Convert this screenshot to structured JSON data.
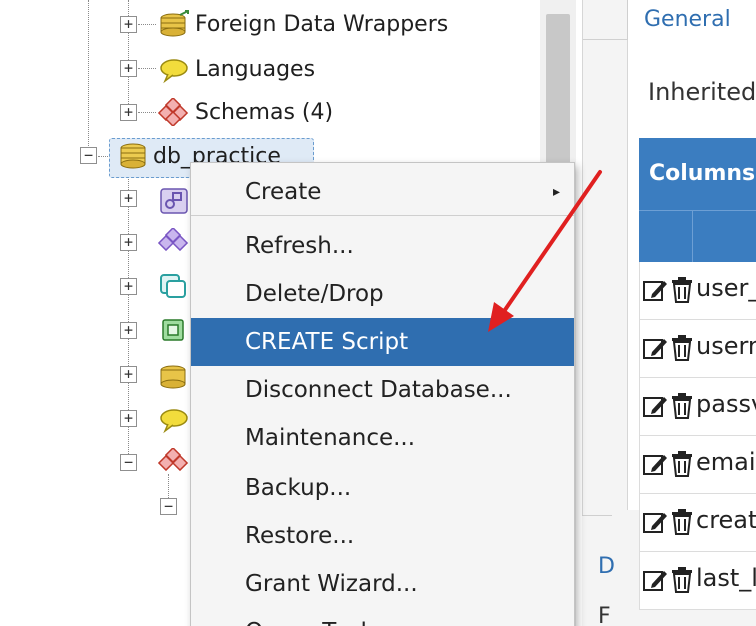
{
  "tree": {
    "nodes": [
      {
        "label": "Foreign Data Wrappers",
        "icon": "foreign-data-wrapper-icon"
      },
      {
        "label": "Languages",
        "icon": "language-icon"
      },
      {
        "label": "Schemas (4)",
        "icon": "schema-icon"
      },
      {
        "label": "db_practice",
        "icon": "database-icon"
      }
    ],
    "expander_collapsed": "+",
    "expander_expanded": "−"
  },
  "context_menu": {
    "items": [
      {
        "label": "Create",
        "submenu_caret": "▸"
      },
      {
        "label": "Refresh..."
      },
      {
        "label": "Delete/Drop"
      },
      {
        "label": "CREATE Script",
        "highlighted": true
      },
      {
        "label": "Disconnect Database..."
      },
      {
        "label": "Maintenance..."
      },
      {
        "label": "Backup..."
      },
      {
        "label": "Restore..."
      },
      {
        "label": "Grant Wizard..."
      },
      {
        "label": "Query Tool"
      }
    ]
  },
  "properties": {
    "tab": "General",
    "inherited_label": "Inherited",
    "columns_header": "Columns",
    "column_rows": [
      "user_",
      "usern",
      "passv",
      "emai",
      "creat",
      "last_l"
    ],
    "bottom_tabs": [
      "D",
      "F"
    ]
  },
  "colors": {
    "accent": "#2f6eb0",
    "menu_highlight": "#2f6eb0",
    "columns_header": "#3b7dc0",
    "annotation_arrow": "#e02020",
    "selection_fill": "#dfeaf6"
  }
}
